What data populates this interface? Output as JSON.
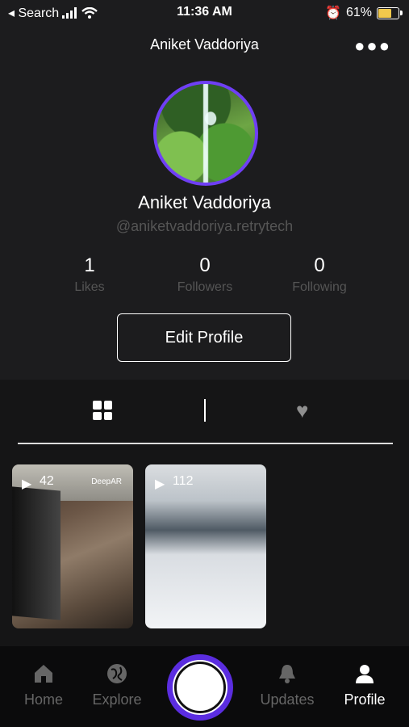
{
  "status_bar": {
    "back_label": "◂ Search",
    "time": "11:36 AM",
    "battery_text": "61%",
    "battery_level": 0.61,
    "battery_color": "#f2c94c"
  },
  "header": {
    "title": "Aniket Vaddoriya",
    "more_icon": "more-dots-icon"
  },
  "profile": {
    "name": "Aniket Vaddoriya",
    "handle": "@aniketvaddoriya.retrytech",
    "accent_color": "#6f3ff5"
  },
  "stats": [
    {
      "value": "1",
      "label": "Likes"
    },
    {
      "value": "0",
      "label": "Followers"
    },
    {
      "value": "0",
      "label": "Following"
    }
  ],
  "edit_profile_label": "Edit Profile",
  "content_tabs": {
    "grid_icon": "grid-icon",
    "liked_icon": "heart-icon"
  },
  "videos": [
    {
      "views": "42",
      "watermark": "DeepAR"
    },
    {
      "views": "112"
    }
  ],
  "bottom_nav": [
    {
      "label": "Home",
      "icon": "home-icon"
    },
    {
      "label": "Explore",
      "icon": "globe-icon"
    },
    {
      "label": "Updates",
      "icon": "bell-icon"
    },
    {
      "label": "Profile",
      "icon": "person-icon"
    }
  ]
}
